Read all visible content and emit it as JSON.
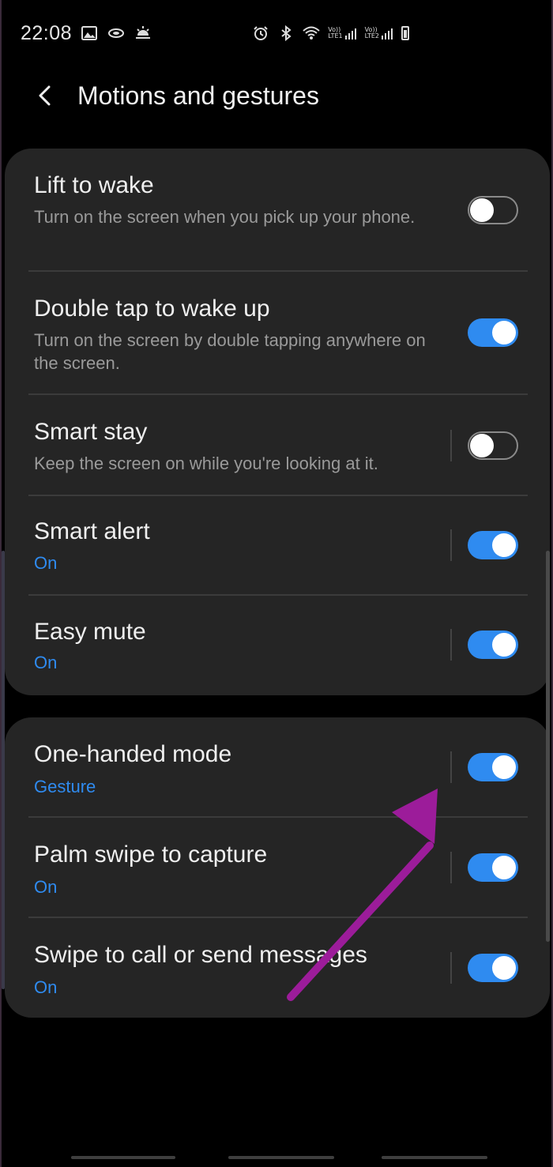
{
  "status_bar": {
    "time": "22:08",
    "left_icons": [
      "gallery-icon",
      "sync-icon",
      "weather-icon"
    ],
    "right_icons": [
      "alarm-icon",
      "bluetooth-icon",
      "wifi-icon"
    ],
    "sim1_label_top": "Vo))",
    "sim1_label_bottom": "LTE1",
    "sim2_label_top": "Vo))",
    "sim2_label_bottom": "LTE2"
  },
  "header": {
    "title": "Motions and gestures",
    "back_icon": "chevron-left-icon"
  },
  "colors": {
    "accent": "#2f8bf0",
    "card_bg": "#252525",
    "arrow": "#9c1c9a"
  },
  "group1": [
    {
      "title": "Lift to wake",
      "subtitle": "Turn on the screen when you pick up your phone.",
      "subtitle_style": "gray",
      "state": "off"
    },
    {
      "title": "Double tap to wake up",
      "subtitle": "Turn on the screen by double tapping anywhere on the screen.",
      "subtitle_style": "gray",
      "state": "on"
    },
    {
      "title": "Smart stay",
      "subtitle": "Keep the screen on while you're looking at it.",
      "subtitle_style": "gray",
      "state": "off"
    },
    {
      "title": "Smart alert",
      "subtitle": "On",
      "subtitle_style": "accent",
      "state": "on"
    },
    {
      "title": "Easy mute",
      "subtitle": "On",
      "subtitle_style": "accent",
      "state": "on"
    }
  ],
  "group2": [
    {
      "title": "One-handed mode",
      "subtitle": "Gesture",
      "subtitle_style": "accent",
      "state": "on"
    },
    {
      "title": "Palm swipe to capture",
      "subtitle": "On",
      "subtitle_style": "accent",
      "state": "on"
    },
    {
      "title": "Swipe to call or send messages",
      "subtitle": "On",
      "subtitle_style": "accent",
      "state": "on"
    }
  ]
}
